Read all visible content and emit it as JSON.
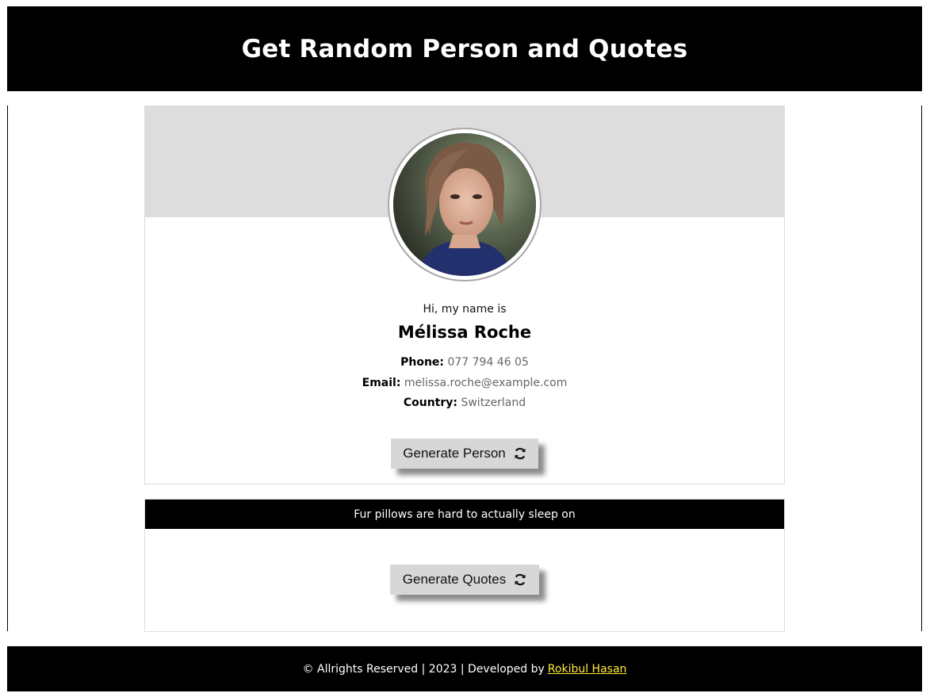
{
  "header": {
    "title": "Get Random Person and Quotes"
  },
  "person": {
    "greeting": "Hi, my name is",
    "name": "Mélissa Roche",
    "phone_label": "Phone:",
    "phone": "077 794 46 05",
    "email_label": "Email:",
    "email": "melissa.roche@example.com",
    "country_label": "Country:",
    "country": "Switzerland",
    "button_label": "Generate Person",
    "button_icon": "refresh-icon"
  },
  "quote": {
    "text": "Fur pillows are hard to actually sleep on",
    "button_label": "Generate Quotes",
    "button_icon": "refresh-icon"
  },
  "footer": {
    "text": "© Allrights Reserved | 2023 | Developed by",
    "author_link": "Rokibul Hasan",
    "link_color": "#ffeb3b"
  },
  "colors": {
    "header_bg": "#000000",
    "banner_bg": "#dddddd",
    "button_bg": "#d7d7d7"
  }
}
